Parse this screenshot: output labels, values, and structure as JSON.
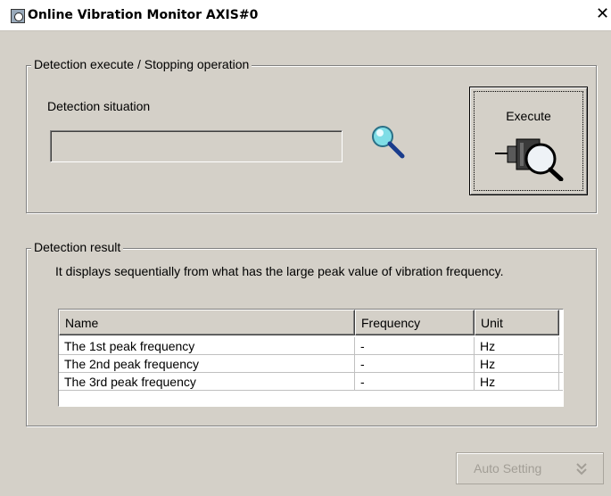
{
  "window": {
    "title": "Online Vibration Monitor AXIS#0",
    "close_symbol": "✕",
    "icon": "app-monitor-icon"
  },
  "detection_group": {
    "legend": "Detection execute / Stopping operation",
    "situation_label": "Detection situation",
    "situation_value": "",
    "status_icon": "magnifier-icon",
    "execute_button": {
      "label": "Execute",
      "icon": "sensor-magnifier-icon"
    }
  },
  "result_group": {
    "legend": "Detection result",
    "description": "It displays sequentially from what has the large peak value of vibration frequency.",
    "table": {
      "columns": [
        "Name",
        "Frequency",
        "Unit"
      ],
      "rows": [
        [
          "The 1st peak frequency",
          "-",
          "Hz"
        ],
        [
          "The 2nd peak frequency",
          "-",
          "Hz"
        ],
        [
          "The 3rd peak frequency",
          "-",
          "Hz"
        ]
      ]
    }
  },
  "auto_setting_button": {
    "label": "Auto Setting",
    "icon": "double-chevron-down-icon",
    "enabled": false
  },
  "colors": {
    "window_bg": "#d4d0c8",
    "disabled_text": "#a29e96",
    "magnifier_lens": "#7fdde6",
    "magnifier_handle": "#1a3c8c"
  }
}
